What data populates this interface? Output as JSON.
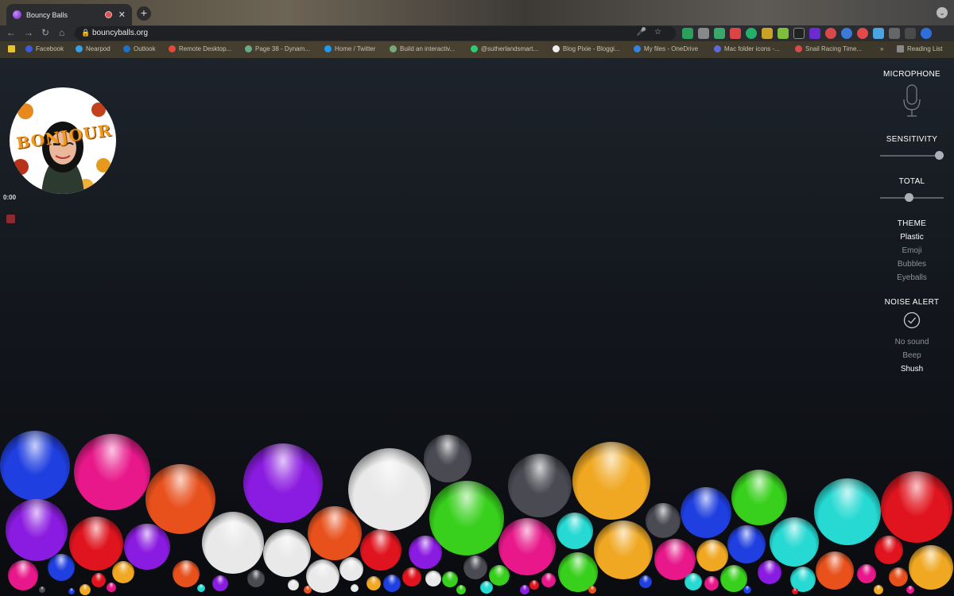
{
  "browser": {
    "tab_title": "Bouncy Balls",
    "url": "bouncyballs.org",
    "bookmarks": [
      "Facebook",
      "Nearpod",
      "Outlook",
      "Remote Desktop...",
      "Page 38 - Dynam...",
      "Home / Twitter",
      "Build an interactiv...",
      "@sutherlandsmart...",
      "Blog Pixie - Bloggi...",
      "My files - OneDrive",
      "Mac folder icons -...",
      "Snail Racing Time...",
      "»",
      "Reading List"
    ]
  },
  "avatar": {
    "greeting": "BONJOUR"
  },
  "timer": "0:00",
  "controls": {
    "microphone_label": "MICROPHONE",
    "sensitivity_label": "SENSITIVITY",
    "sensitivity_value": 1.0,
    "total_label": "TOTAL",
    "total_value": 0.45,
    "theme_label": "THEME",
    "themes": [
      "Plastic",
      "Emoji",
      "Bubbles",
      "Eyeballs"
    ],
    "selected_theme": "Plastic",
    "noise_alert_label": "NOISE ALERT",
    "noise_options": [
      "No sound",
      "Beep",
      "Shush"
    ],
    "selected_noise": "Shush"
  },
  "colors": {
    "blue": "#1f3fe0",
    "pink": "#e8188a",
    "orange": "#e8501c",
    "purple": "#8a1be0",
    "white": "#e9e9e9",
    "gray": "#4a4b52",
    "yellow": "#f0a822",
    "green": "#38d01c",
    "cyan": "#26d9d2",
    "red": "#e0141e"
  }
}
